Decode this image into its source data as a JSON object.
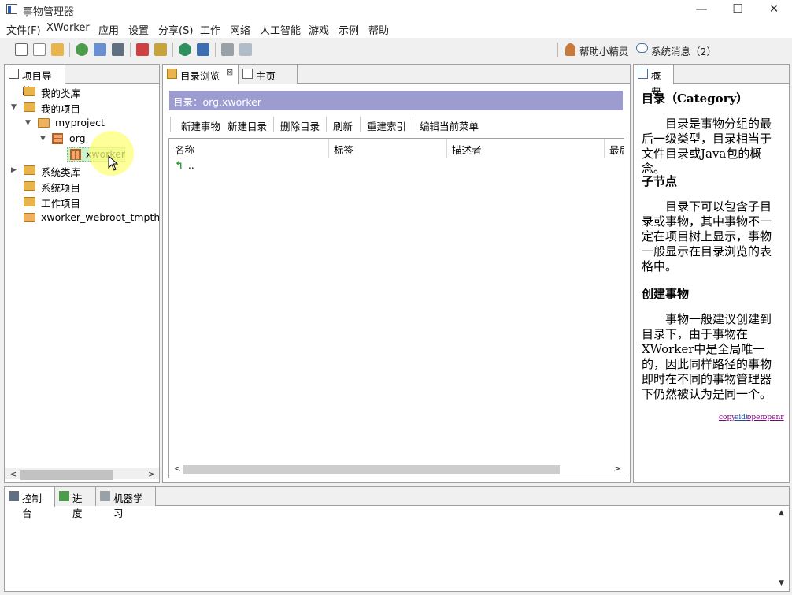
{
  "window": {
    "title": "事物管理器",
    "minimize": "—",
    "maximize": "☐",
    "close": "✕"
  },
  "menu": [
    "文件(F)",
    "XWorker",
    "应用",
    "设置",
    "分享(S)",
    "工作",
    "网络",
    "人工智能",
    "游戏",
    "示例",
    "帮助"
  ],
  "toolbar": {
    "helper": "帮助小精灵",
    "messages": "系统消息（2）"
  },
  "nav": {
    "tab": "项目导航",
    "tree": [
      {
        "label": "我的类库"
      },
      {
        "label": "我的项目"
      },
      {
        "label": "myproject"
      },
      {
        "label": "org"
      },
      {
        "label": "xworker"
      },
      {
        "label": "系统类库"
      },
      {
        "label": "系统项目"
      },
      {
        "label": "工作项目"
      },
      {
        "label": "xworker_webroot_tmpthin"
      }
    ]
  },
  "center": {
    "tabs": [
      {
        "label": "目录浏览"
      },
      {
        "label": "主页"
      }
    ],
    "tab_close": "⊠",
    "header": "目录：org.xworker",
    "actions": [
      "新建事物",
      "新建目录",
      "删除目录",
      "刷新",
      "重建索引",
      "编辑当前菜单"
    ],
    "columns": [
      "名称",
      "标签",
      "描述者",
      "最后"
    ],
    "rows": [
      {
        "name": ".."
      }
    ]
  },
  "overview": {
    "tab": "概要",
    "title": "目录（Category）",
    "p1": "目录是事物分组的最后一级类型，目录相当于文件目录或Java包的概念。",
    "h2": "子节点",
    "p2": "目录下可以包含子目录或事物，其中事物不一定在项目树上显示，事物一般显示在目录浏览的表格中。",
    "h3": "创建事物",
    "p3": "事物一般建议创建到目录下，由于事物在XWorker中是全局唯一的，因此同样路径的事物即时在不同的事物管理器下仍然被认为是同一个。",
    "links": [
      "copy",
      "eidt",
      "open",
      "openr"
    ]
  },
  "bottom": {
    "tabs": [
      "控制台",
      "进度",
      "机器学习"
    ]
  },
  "colors": {
    "header_bg": "#9c9cd0",
    "selection": "#ccf3cc",
    "folder": "#e9b44c"
  }
}
